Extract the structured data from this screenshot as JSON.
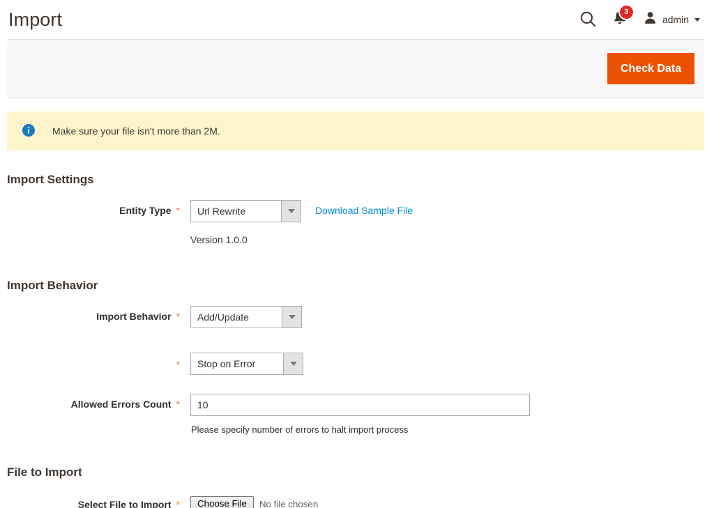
{
  "header": {
    "title": "Import",
    "search_icon": "search-icon",
    "notifications": {
      "icon": "bell-icon",
      "count": "3"
    },
    "user": {
      "avatar_icon": "user-avatar-icon",
      "name": "admin",
      "caret_icon": "chevron-down-icon"
    }
  },
  "toolbar": {
    "check_data_label": "Check Data"
  },
  "notice": {
    "icon": "info-circle-icon",
    "text": "Make sure your file isn't more than 2M."
  },
  "import_settings": {
    "legend": "Import Settings",
    "entity_type": {
      "label": "Entity Type",
      "required_marker": "*",
      "value": "Url Rewrite",
      "arrow_icon": "chevron-down-icon",
      "sample_link": "Download Sample File"
    },
    "version_note": "Version 1.0.0"
  },
  "import_behavior": {
    "legend": "Import Behavior",
    "behavior": {
      "label": "Import Behavior",
      "required_marker": "*",
      "value": "Add/Update",
      "arrow_icon": "chevron-down-icon"
    },
    "error_handling": {
      "required_marker": "*",
      "value": "Stop on Error",
      "arrow_icon": "chevron-down-icon"
    },
    "allowed_errors": {
      "label": "Allowed Errors Count",
      "required_marker": "*",
      "value": "10",
      "placeholder": "",
      "note": "Please specify number of errors to halt import process"
    }
  },
  "file_to_import": {
    "legend": "File to Import",
    "select_file": {
      "label": "Select File to Import",
      "required_marker": "*",
      "button_label": "Choose File",
      "status": "No file chosen"
    }
  },
  "colors": {
    "accent_orange": "#eb5202",
    "link_blue": "#008bdb",
    "notice_yellow": "#fcf5cc",
    "badge_red": "#e22626",
    "required_orange": "#ee7c44"
  }
}
